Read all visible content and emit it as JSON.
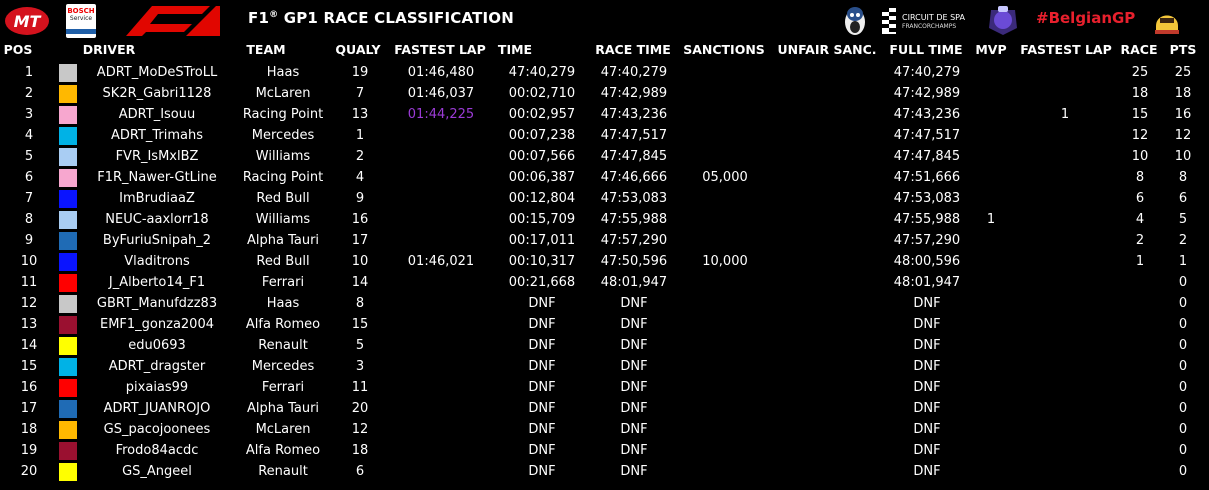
{
  "header": {
    "title": "F1",
    "title_mark": "®",
    "title_rest": " GP1 RACE CLASSIFICATION",
    "hashtag": "#BelgianGP",
    "mt_logo_text": "MT",
    "bosch_text_1": "BOSCH",
    "bosch_text_2": "Service",
    "spa_text_1": "CIRCUIT DE SPA",
    "spa_text_2": "FRANCORCHAMPS"
  },
  "columns": {
    "pos": "POS",
    "driver": "DRIVER",
    "team": "TEAM",
    "qualy": "QUALY",
    "fastest_lap": "FASTEST LAP",
    "time": "TIME",
    "race_time": "RACE TIME",
    "sanctions": "SANCTIONS",
    "unfair_sanc": "UNFAIR SANC.",
    "full_time": "FULL TIME",
    "mvp": "MVP",
    "fastest_lap_pts": "FASTEST LAP",
    "race": "RACE",
    "pts": "PTS"
  },
  "colors": {
    "haas": "#c8c8c8",
    "mclaren": "#ffb800",
    "racing_point": "#f7a7cf",
    "mercedes": "#00b2e6",
    "williams": "#a9cdf3",
    "red_bull": "#0a14ff",
    "alpha_tauri": "#1f6bb5",
    "ferrari": "#ff0000",
    "alfa_romeo": "#9a1030",
    "renault": "#ffff00",
    "fastest_lap_highlight": "#9b3bd6",
    "hashtag": "#e8202d"
  },
  "rows": [
    {
      "pos": "1",
      "driver": "ADRT_MoDeSTroLL",
      "team": "Haas",
      "team_color": "#c8c8c8",
      "qualy": "19",
      "fastest_lap": "01:46,480",
      "time": "47:40,279",
      "race_time": "47:40,279",
      "sanctions": "",
      "unfair": "",
      "full_time": "47:40,279",
      "mvp": "",
      "fl_pts": "",
      "race": "25",
      "pts": "25"
    },
    {
      "pos": "2",
      "driver": "SK2R_Gabri1128",
      "team": "McLaren",
      "team_color": "#ffb800",
      "qualy": "7",
      "fastest_lap": "01:46,037",
      "time": "00:02,710",
      "race_time": "47:42,989",
      "sanctions": "",
      "unfair": "",
      "full_time": "47:42,989",
      "mvp": "",
      "fl_pts": "",
      "race": "18",
      "pts": "18"
    },
    {
      "pos": "3",
      "driver": "ADRT_Isouu",
      "team": "Racing Point",
      "team_color": "#f7a7cf",
      "qualy": "13",
      "fastest_lap": "01:44,225",
      "fastest_lap_purple": true,
      "time": "00:02,957",
      "race_time": "47:43,236",
      "sanctions": "",
      "unfair": "",
      "full_time": "47:43,236",
      "mvp": "",
      "fl_pts": "1",
      "race": "15",
      "pts": "16"
    },
    {
      "pos": "4",
      "driver": "ADRT_Trimahs",
      "team": "Mercedes",
      "team_color": "#00b2e6",
      "qualy": "1",
      "fastest_lap": "",
      "time": "00:07,238",
      "race_time": "47:47,517",
      "sanctions": "",
      "unfair": "",
      "full_time": "47:47,517",
      "mvp": "",
      "fl_pts": "",
      "race": "12",
      "pts": "12"
    },
    {
      "pos": "5",
      "driver": "FVR_IsMxlBZ",
      "team": "Williams",
      "team_color": "#a9cdf3",
      "qualy": "2",
      "fastest_lap": "",
      "time": "00:07,566",
      "race_time": "47:47,845",
      "sanctions": "",
      "unfair": "",
      "full_time": "47:47,845",
      "mvp": "",
      "fl_pts": "",
      "race": "10",
      "pts": "10"
    },
    {
      "pos": "6",
      "driver": "F1R_Nawer-GtLine",
      "team": "Racing Point",
      "team_color": "#f7a7cf",
      "qualy": "4",
      "fastest_lap": "",
      "time": "00:06,387",
      "race_time": "47:46,666",
      "sanctions": "05,000",
      "unfair": "",
      "full_time": "47:51,666",
      "mvp": "",
      "fl_pts": "",
      "race": "8",
      "pts": "8"
    },
    {
      "pos": "7",
      "driver": "ImBrudiaaZ",
      "team": "Red Bull",
      "team_color": "#0a14ff",
      "qualy": "9",
      "fastest_lap": "",
      "time": "00:12,804",
      "race_time": "47:53,083",
      "sanctions": "",
      "unfair": "",
      "full_time": "47:53,083",
      "mvp": "",
      "fl_pts": "",
      "race": "6",
      "pts": "6"
    },
    {
      "pos": "8",
      "driver": "NEUC-aaxlorr18",
      "team": "Williams",
      "team_color": "#a9cdf3",
      "qualy": "16",
      "fastest_lap": "",
      "time": "00:15,709",
      "race_time": "47:55,988",
      "sanctions": "",
      "unfair": "",
      "full_time": "47:55,988",
      "mvp": "1",
      "fl_pts": "",
      "race": "4",
      "pts": "5"
    },
    {
      "pos": "9",
      "driver": "ByFuriuSnipah_2",
      "team": "Alpha Tauri",
      "team_color": "#1f6bb5",
      "qualy": "17",
      "fastest_lap": "",
      "time": "00:17,011",
      "race_time": "47:57,290",
      "sanctions": "",
      "unfair": "",
      "full_time": "47:57,290",
      "mvp": "",
      "fl_pts": "",
      "race": "2",
      "pts": "2"
    },
    {
      "pos": "10",
      "driver": "Vladitrons",
      "team": "Red Bull",
      "team_color": "#0a14ff",
      "qualy": "10",
      "fastest_lap": "01:46,021",
      "time": "00:10,317",
      "race_time": "47:50,596",
      "sanctions": "10,000",
      "unfair": "",
      "full_time": "48:00,596",
      "mvp": "",
      "fl_pts": "",
      "race": "1",
      "pts": "1"
    },
    {
      "pos": "11",
      "driver": "J_Alberto14_F1",
      "team": "Ferrari",
      "team_color": "#ff0000",
      "qualy": "14",
      "fastest_lap": "",
      "time": "00:21,668",
      "race_time": "48:01,947",
      "sanctions": "",
      "unfair": "",
      "full_time": "48:01,947",
      "mvp": "",
      "fl_pts": "",
      "race": "",
      "pts": "0"
    },
    {
      "pos": "12",
      "driver": "GBRT_Manufdzz83",
      "team": "Haas",
      "team_color": "#c8c8c8",
      "qualy": "8",
      "fastest_lap": "",
      "time": "DNF",
      "race_time": "DNF",
      "sanctions": "",
      "unfair": "",
      "full_time": "DNF",
      "mvp": "",
      "fl_pts": "",
      "race": "",
      "pts": "0"
    },
    {
      "pos": "13",
      "driver": "EMF1_gonza2004",
      "team": "Alfa Romeo",
      "team_color": "#9a1030",
      "qualy": "15",
      "fastest_lap": "",
      "time": "DNF",
      "race_time": "DNF",
      "sanctions": "",
      "unfair": "",
      "full_time": "DNF",
      "mvp": "",
      "fl_pts": "",
      "race": "",
      "pts": "0"
    },
    {
      "pos": "14",
      "driver": "edu0693",
      "team": "Renault",
      "team_color": "#ffff00",
      "qualy": "5",
      "fastest_lap": "",
      "time": "DNF",
      "race_time": "DNF",
      "sanctions": "",
      "unfair": "",
      "full_time": "DNF",
      "mvp": "",
      "fl_pts": "",
      "race": "",
      "pts": "0"
    },
    {
      "pos": "15",
      "driver": "ADRT_dragster",
      "team": "Mercedes",
      "team_color": "#00b2e6",
      "qualy": "3",
      "fastest_lap": "",
      "time": "DNF",
      "race_time": "DNF",
      "sanctions": "",
      "unfair": "",
      "full_time": "DNF",
      "mvp": "",
      "fl_pts": "",
      "race": "",
      "pts": "0"
    },
    {
      "pos": "16",
      "driver": "pixaias99",
      "team": "Ferrari",
      "team_color": "#ff0000",
      "qualy": "11",
      "fastest_lap": "",
      "time": "DNF",
      "race_time": "DNF",
      "sanctions": "",
      "unfair": "",
      "full_time": "DNF",
      "mvp": "",
      "fl_pts": "",
      "race": "",
      "pts": "0"
    },
    {
      "pos": "17",
      "driver": "ADRT_JUANROJO",
      "team": "Alpha Tauri",
      "team_color": "#1f6bb5",
      "qualy": "20",
      "fastest_lap": "",
      "time": "DNF",
      "race_time": "DNF",
      "sanctions": "",
      "unfair": "",
      "full_time": "DNF",
      "mvp": "",
      "fl_pts": "",
      "race": "",
      "pts": "0"
    },
    {
      "pos": "18",
      "driver": "GS_pacojoonees",
      "team": "McLaren",
      "team_color": "#ffb800",
      "qualy": "12",
      "fastest_lap": "",
      "time": "DNF",
      "race_time": "DNF",
      "sanctions": "",
      "unfair": "",
      "full_time": "DNF",
      "mvp": "",
      "fl_pts": "",
      "race": "",
      "pts": "0"
    },
    {
      "pos": "19",
      "driver": "Frodo84acdc",
      "team": "Alfa Romeo",
      "team_color": "#9a1030",
      "qualy": "18",
      "fastest_lap": "",
      "time": "DNF",
      "race_time": "DNF",
      "sanctions": "",
      "unfair": "",
      "full_time": "DNF",
      "mvp": "",
      "fl_pts": "",
      "race": "",
      "pts": "0"
    },
    {
      "pos": "20",
      "driver": "GS_Angeel",
      "team": "Renault",
      "team_color": "#ffff00",
      "qualy": "6",
      "fastest_lap": "",
      "time": "DNF",
      "race_time": "DNF",
      "sanctions": "",
      "unfair": "",
      "full_time": "DNF",
      "mvp": "",
      "fl_pts": "",
      "race": "",
      "pts": "0"
    }
  ]
}
